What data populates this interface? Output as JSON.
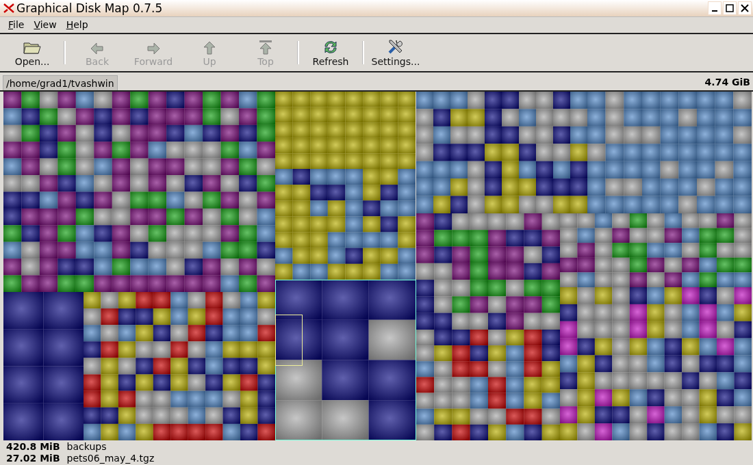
{
  "window": {
    "title": "Graphical Disk Map 0.7.5"
  },
  "menu": [
    {
      "label": "File"
    },
    {
      "label": "View"
    },
    {
      "label": "Help"
    }
  ],
  "toolbar": [
    {
      "kind": "button",
      "label": "Open...",
      "disabled": false
    },
    {
      "kind": "separator"
    },
    {
      "kind": "button",
      "label": "Back",
      "disabled": true
    },
    {
      "kind": "button",
      "label": "Forward",
      "disabled": true
    },
    {
      "kind": "button",
      "label": "Up",
      "disabled": true
    },
    {
      "kind": "button",
      "label": "Top",
      "disabled": true
    },
    {
      "kind": "separator"
    },
    {
      "kind": "button",
      "label": "Refresh",
      "disabled": false
    },
    {
      "kind": "separator"
    },
    {
      "kind": "button",
      "label": "Settings...",
      "disabled": false
    }
  ],
  "path_bar": {
    "path": "/home/grad1/tvashwin",
    "total": "4.74 GiB"
  },
  "status_bar": [
    {
      "size": "420.8 MiB",
      "name": "backups"
    },
    {
      "size": "27.02 MiB",
      "name": "pets06_may_4.tgz"
    }
  ]
}
